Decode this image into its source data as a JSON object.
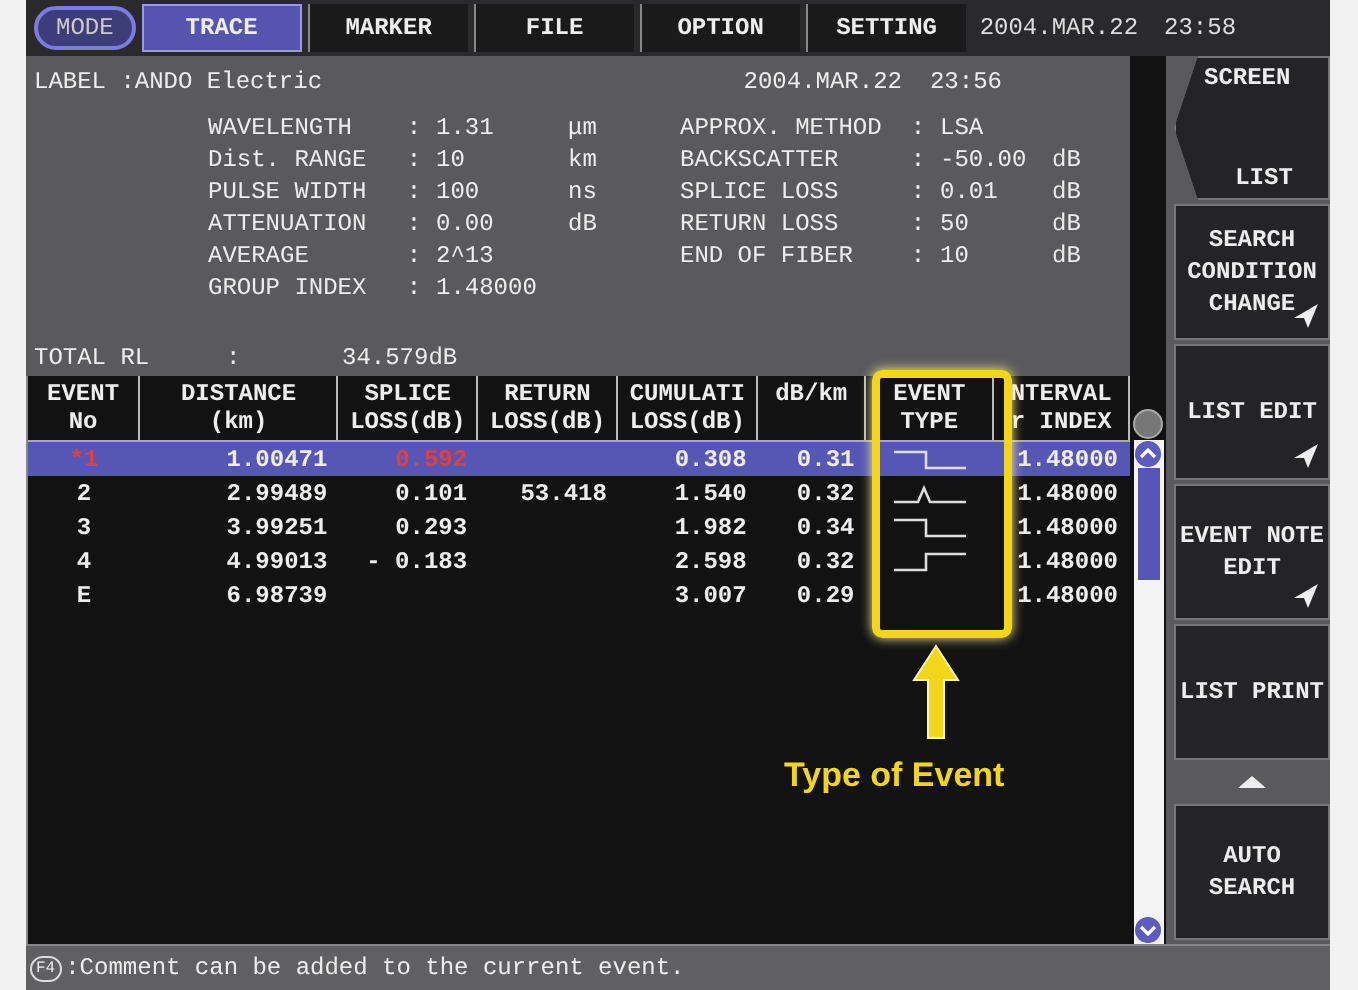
{
  "top_bar": {
    "mode": "MODE",
    "tabs": [
      {
        "label": "TRACE",
        "selected": true
      },
      {
        "label": "MARKER",
        "selected": false
      },
      {
        "label": "FILE",
        "selected": false
      },
      {
        "label": "OPTION",
        "selected": false
      },
      {
        "label": "SETTING",
        "selected": false
      }
    ],
    "date": "2004.MAR.22",
    "time": "23:58"
  },
  "info": {
    "label": "LABEL :ANDO Electric",
    "date": "2004.MAR.22",
    "time": "23:56",
    "left_params": [
      {
        "name": "WAVELENGTH",
        "sep": ":",
        "value": "1.31",
        "unit": "μm"
      },
      {
        "name": "Dist. RANGE",
        "sep": ":",
        "value": "10",
        "unit": "km"
      },
      {
        "name": "PULSE WIDTH",
        "sep": ":",
        "value": "100",
        "unit": "ns"
      },
      {
        "name": "ATTENUATION",
        "sep": ":",
        "value": "0.00",
        "unit": "dB"
      },
      {
        "name": "AVERAGE",
        "sep": ":",
        "value": "2^13"
      },
      {
        "name": "GROUP INDEX",
        "sep": ":",
        "value": "1.48000"
      }
    ],
    "right_params": [
      {
        "name": "APPROX. METHOD",
        "sep": ":",
        "value": "LSA"
      },
      {
        "name": "BACKSCATTER",
        "sep": ":",
        "value": "-50.00",
        "unit": "dB"
      },
      {
        "name": "SPLICE LOSS",
        "sep": ":",
        "value": "0.01",
        "unit": "dB"
      },
      {
        "name": "RETURN LOSS",
        "sep": ":",
        "value": "50",
        "unit": "dB"
      },
      {
        "name": "END OF FIBER",
        "sep": ":",
        "value": "10",
        "unit": "dB"
      }
    ]
  },
  "total_rl": {
    "label": "TOTAL RL",
    "sep": ":",
    "value": "34.579dB"
  },
  "table": {
    "columns": [
      {
        "top": "EVENT",
        "bottom": "No"
      },
      {
        "top": "DISTANCE",
        "bottom": "(km)"
      },
      {
        "top": "SPLICE",
        "bottom": "LOSS(dB)"
      },
      {
        "top": "RETURN",
        "bottom": "LOSS(dB)"
      },
      {
        "top": "CUMULATI",
        "bottom": "LOSS(dB)"
      },
      {
        "top": "dB/km"
      },
      {
        "top": "EVENT",
        "bottom": "TYPE"
      },
      {
        "top": "NTERVAL",
        "bottom": "r INDEX"
      }
    ],
    "rows": [
      {
        "selected": true,
        "no": "*1",
        "distance": "1.00471",
        "splice": "0.592",
        "cumulative": "0.308",
        "db_km": "0.31",
        "kind": "loss",
        "index": "1.48000"
      },
      {
        "selected": false,
        "no": "2",
        "distance": "2.99489",
        "splice": "0.101",
        "return": "53.418",
        "cumulative": "1.540",
        "db_km": "0.32",
        "kind": "reflection",
        "index": "1.48000"
      },
      {
        "selected": false,
        "no": "3",
        "distance": "3.99251",
        "splice": "0.293",
        "cumulative": "1.982",
        "db_km": "0.34",
        "kind": "loss",
        "index": "1.48000"
      },
      {
        "selected": false,
        "no": "4",
        "distance": "4.99013",
        "splice": "- 0.183",
        "cumulative": "2.598",
        "db_km": "0.32",
        "kind": "gain",
        "index": "1.48000"
      },
      {
        "selected": false,
        "no": "E",
        "distance": "6.98739",
        "cumulative": "3.007",
        "db_km": "0.29",
        "index": "1.48000"
      }
    ]
  },
  "annotation": {
    "label": "Type of Event"
  },
  "soft_keys": [
    {
      "title": "SCREEN",
      "label": "LIST",
      "submenu": false
    },
    {
      "label": "SEARCH CONDITION CHANGE",
      "submenu": true
    },
    {
      "label": "LIST EDIT",
      "submenu": true
    },
    {
      "label": "EVENT NOTE EDIT",
      "submenu": true
    },
    {
      "label": "LIST PRINT",
      "submenu": false
    },
    {
      "label": "AUTO SEARCH",
      "submenu": false
    }
  ],
  "status_bar": {
    "key": "F4",
    "text": ":Comment can be added to the current event."
  }
}
